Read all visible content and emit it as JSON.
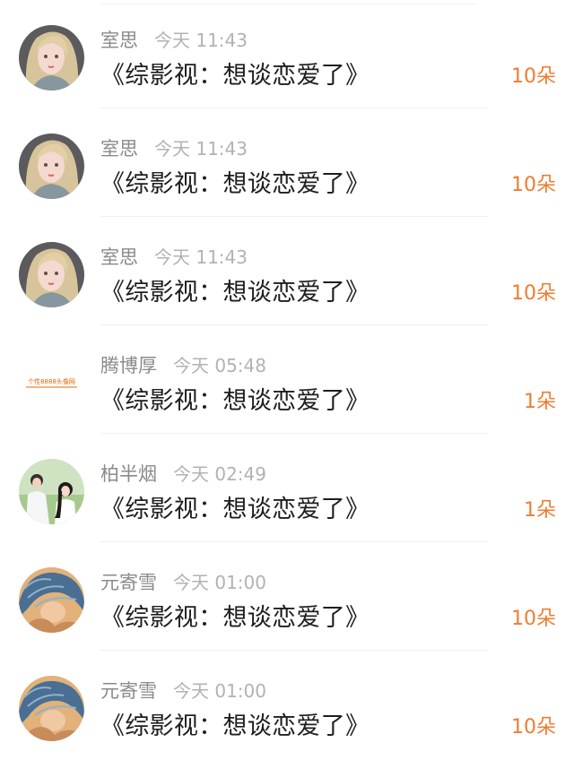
{
  "comments": [
    {
      "name": "室思",
      "time": "今天 11:43",
      "text": "《综影视：想谈恋爱了》",
      "count": "10朵",
      "avatar": "avatar-blonde-girl"
    },
    {
      "name": "室思",
      "time": "今天 11:43",
      "text": "《综影视：想谈恋爱了》",
      "count": "10朵",
      "avatar": "avatar-blonde-girl"
    },
    {
      "name": "室思",
      "time": "今天 11:43",
      "text": "《综影视：想谈恋爱了》",
      "count": "10朵",
      "avatar": "avatar-blonde-girl"
    },
    {
      "name": "腾博厚",
      "time": "今天 05:48",
      "text": "《综影视：想谈恋爱了》",
      "count": "1朵",
      "avatar": "avatar-default-text",
      "avatar_text": "个性8888头像网"
    },
    {
      "name": "柏半烟",
      "time": "今天 02:49",
      "text": "《综影视：想谈恋爱了》",
      "count": "1朵",
      "avatar": "avatar-couple"
    },
    {
      "name": "元寄雪",
      "time": "今天 01:00",
      "text": "《综影视：想谈恋爱了》",
      "count": "10朵",
      "avatar": "avatar-blue-hair"
    },
    {
      "name": "元寄雪",
      "time": "今天 01:00",
      "text": "《综影视：想谈恋爱了》",
      "count": "10朵",
      "avatar": "avatar-blue-hair"
    }
  ],
  "colors": {
    "name": "#8a8a8a",
    "time": "#b2b2b2",
    "content": "#1e1e1e",
    "count": "#f07c30"
  }
}
